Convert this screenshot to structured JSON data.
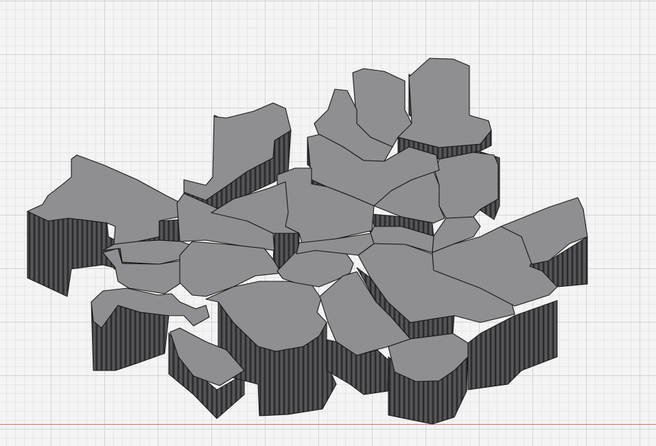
{
  "viewport": {
    "background_color": "#f4f4f4",
    "grid_minor_color": "#e6e6e6",
    "grid_major_color": "#d2d2d2",
    "x_axis_color": "#e06a6a",
    "grid_visible": true
  },
  "model": {
    "type": "extruded-district-map",
    "top_face_color": "#8f8f91",
    "wall_color": "#4a4a4d",
    "edge_color": "#161616"
  }
}
